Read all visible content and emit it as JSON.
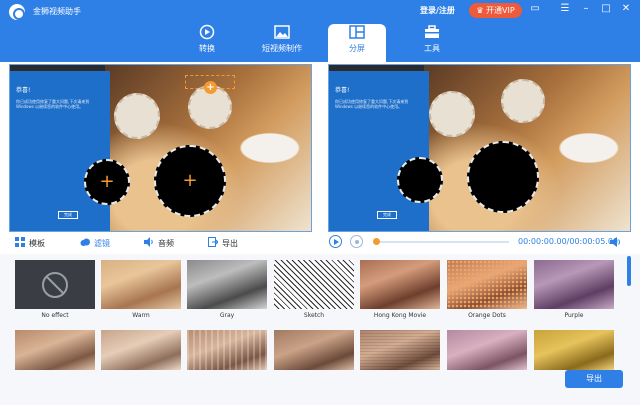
{
  "app": {
    "title": "金狮视频助手",
    "login": "登录/注册",
    "vip": "开通VIP"
  },
  "nav": [
    {
      "id": "convert",
      "label": "转换",
      "icon": "convert-icon"
    },
    {
      "id": "short-video",
      "label": "短视频制作",
      "icon": "image-icon"
    },
    {
      "id": "split-screen",
      "label": "分屏",
      "icon": "split-screen-icon",
      "active": true
    },
    {
      "id": "tools",
      "label": "工具",
      "icon": "toolbox-icon"
    }
  ],
  "preview": {
    "text_title": "恭喜!",
    "text_body": "你已成功使用修复了重大问题,下次请来到 Windows 以继续您的软件中心使用。",
    "button": "完成"
  },
  "toolbar": {
    "template": "模板",
    "filter": "滤镜",
    "audio": "音频",
    "export": "导出"
  },
  "player": {
    "time": "00:00:00.00/00:00:05.00",
    "progress": 0.0
  },
  "filters_row1": [
    "No effect",
    "Warm",
    "Gray",
    "Sketch",
    "Hong Kong Movie",
    "Orange Dots",
    "Purple"
  ],
  "filters_row2": [
    "",
    "",
    "",
    "",
    "",
    "",
    ""
  ],
  "export_button": "导出",
  "colors": {
    "brand": "#2e7fe6",
    "vip": "#ee5a3c",
    "accent": "#f39a30"
  }
}
